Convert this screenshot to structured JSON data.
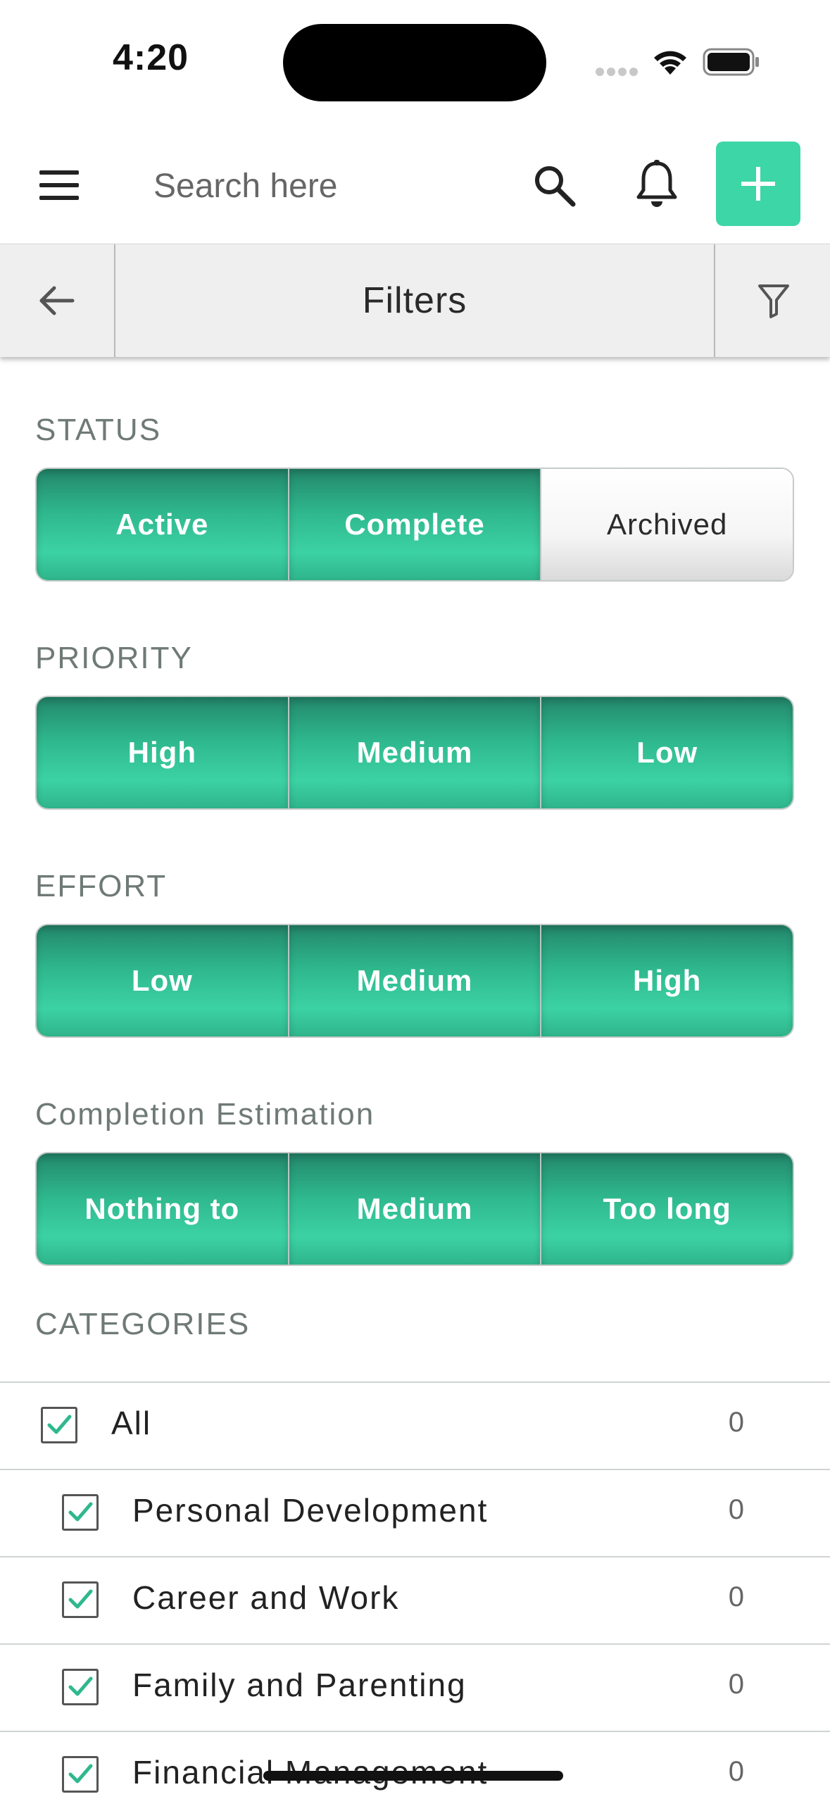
{
  "status_bar": {
    "time": "4:20"
  },
  "toolbar": {
    "search_placeholder": "Search here"
  },
  "filter_bar": {
    "title": "Filters"
  },
  "colors": {
    "accent": "#3dd6a6",
    "selected_segment": "#2fb88d"
  },
  "sections": {
    "status": {
      "label": "STATUS",
      "options": [
        {
          "label": "Active",
          "selected": true
        },
        {
          "label": "Complete",
          "selected": true
        },
        {
          "label": "Archived",
          "selected": false
        }
      ]
    },
    "priority": {
      "label": "PRIORITY",
      "options": [
        {
          "label": "High",
          "selected": true
        },
        {
          "label": "Medium",
          "selected": true
        },
        {
          "label": "Low",
          "selected": true
        }
      ]
    },
    "effort": {
      "label": "EFFORT",
      "options": [
        {
          "label": "Low",
          "selected": true
        },
        {
          "label": "Medium",
          "selected": true
        },
        {
          "label": "High",
          "selected": true
        }
      ]
    },
    "completion": {
      "label": "Completion Estimation",
      "options": [
        {
          "label": "Nothing to",
          "selected": true
        },
        {
          "label": "Medium",
          "selected": true
        },
        {
          "label": "Too long",
          "selected": true
        }
      ]
    }
  },
  "categories": {
    "label": "CATEGORIES",
    "items": [
      {
        "label": "All",
        "count": "0",
        "checked": true
      },
      {
        "label": "Personal Development",
        "count": "0",
        "checked": true
      },
      {
        "label": "Career and Work",
        "count": "0",
        "checked": true
      },
      {
        "label": "Family and Parenting",
        "count": "0",
        "checked": true
      },
      {
        "label": "Financial Management",
        "count": "0",
        "checked": true
      }
    ]
  }
}
